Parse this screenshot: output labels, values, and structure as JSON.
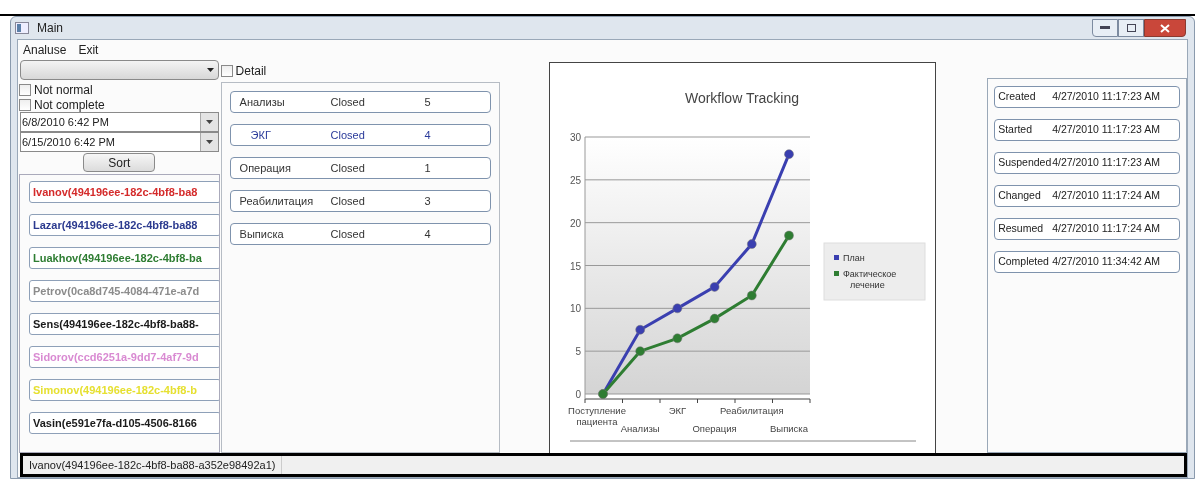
{
  "window": {
    "title": "Main"
  },
  "menu": [
    "Analuse",
    "Exit"
  ],
  "filter": {
    "not_normal": {
      "label": "Not normal",
      "checked": false
    },
    "not_complete": {
      "label": "Not complete",
      "checked": false
    },
    "date_from": "6/8/2010 6:42 PM",
    "date_to": "6/15/2010 6:42 PM",
    "sort_button": "Sort"
  },
  "detail": {
    "label": "Detail",
    "checked": false
  },
  "patients": [
    {
      "text": "Ivanov(494196ee-182c-4bf8-ba8",
      "color": "#d42a2a"
    },
    {
      "text": "Lazar(494196ee-182c-4bf8-ba88",
      "color": "#2b3a8f"
    },
    {
      "text": "Luakhov(494196ee-182c-4bf8-ba",
      "color": "#2e7d32"
    },
    {
      "text": "Petrov(0ca8d745-4084-471e-a7d",
      "color": "#8c8c8c"
    },
    {
      "text": "Sens(494196ee-182c-4bf8-ba88-",
      "color": "#1a1a1a"
    },
    {
      "text": "Sidorov(ccd6251a-9dd7-4af7-9d",
      "color": "#d98ad2"
    },
    {
      "text": "Simonov(494196ee-182c-4bf8-b",
      "color": "#e6e030"
    },
    {
      "text": "Vasin(e591e7fa-d105-4506-8166",
      "color": "#1a1a1a"
    }
  ],
  "stages": [
    {
      "name": "Анализы",
      "status": "Closed",
      "count": "5",
      "selected": false
    },
    {
      "name": "ЭКГ",
      "status": "Closed",
      "count": "4",
      "selected": true
    },
    {
      "name": "Операция",
      "status": "Closed",
      "count": "1",
      "selected": false
    },
    {
      "name": "Реабилитация",
      "status": "Closed",
      "count": "3",
      "selected": false
    },
    {
      "name": "Выписка",
      "status": "Closed",
      "count": "4",
      "selected": false
    }
  ],
  "chart": {
    "chart_data": {
      "type": "line",
      "title": "Workflow Tracking",
      "grid": true,
      "legend": true,
      "categories": [
        "Поступление пациента",
        "Анализы",
        "ЭКГ",
        "Операция",
        "Реабилитация",
        "Выписка"
      ],
      "ylim": [
        0,
        30
      ],
      "yticks": [
        0,
        5,
        10,
        15,
        20,
        25,
        30
      ],
      "series": [
        {
          "name": "План",
          "color": "#3a3fb0",
          "marker": "circle",
          "values": [
            0,
            7.5,
            10,
            12.5,
            17.5,
            28
          ]
        },
        {
          "name": "Фактическое лечение",
          "color": "#2e7d32",
          "marker": "circle",
          "values": [
            0,
            5,
            6.5,
            8.8,
            11.5,
            18.5
          ]
        }
      ]
    }
  },
  "events": [
    {
      "name": "Created",
      "time": "4/27/2010 11:17:23 AM"
    },
    {
      "name": "Started",
      "time": "4/27/2010 11:17:23 AM"
    },
    {
      "name": "Suspended",
      "time": "4/27/2010 11:17:23 AM"
    },
    {
      "name": "Changed",
      "time": "4/27/2010 11:17:24 AM"
    },
    {
      "name": "Resumed",
      "time": "4/27/2010 11:17:24 AM"
    },
    {
      "name": "Completed",
      "time": "4/27/2010 11:34:42 AM"
    }
  ],
  "status_bar": "Ivanov(494196ee-182c-4bf8-ba88-a352e98492a1)"
}
